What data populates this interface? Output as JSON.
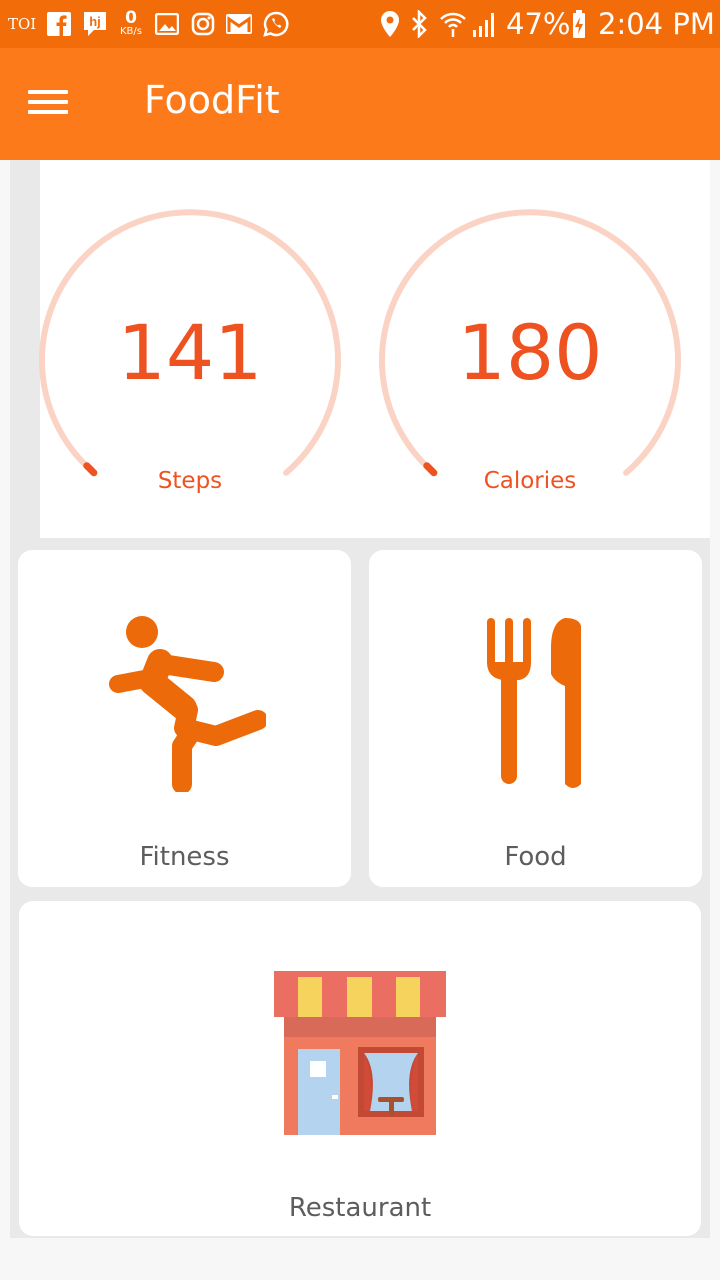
{
  "status_bar": {
    "icons": [
      "toi-icon",
      "facebook-icon",
      "hj-icon",
      "data-speed-icon",
      "gallery-icon",
      "instagram-icon",
      "gmail-icon",
      "whatsapp-icon",
      "location-icon",
      "bluetooth-icon",
      "wifi-icon",
      "signal-icon",
      "battery-charging-icon"
    ],
    "toi_label": "TOI",
    "hj_label": "hj",
    "speed_value": "0",
    "speed_unit": "KB/s",
    "battery": "47%",
    "time": "2:04 PM"
  },
  "app_bar": {
    "title": "FoodFit",
    "menu_icon": "hamburger-menu-icon"
  },
  "gauges": [
    {
      "value": "141",
      "label": "Steps"
    },
    {
      "value": "180",
      "label": "Calories"
    }
  ],
  "cards": [
    {
      "label": "Fitness",
      "icon": "running-person-icon"
    },
    {
      "label": "Food",
      "icon": "fork-knife-icon"
    },
    {
      "label": "Restaurant",
      "icon": "storefront-icon"
    }
  ],
  "colors": {
    "status_bar": "#f26d0a",
    "app_bar": "#fd7a1b",
    "accent": "#ef5221",
    "gauge_track": "#fad3c5",
    "icon_orange": "#ec6a0a",
    "card_label": "#5d5d5d"
  }
}
